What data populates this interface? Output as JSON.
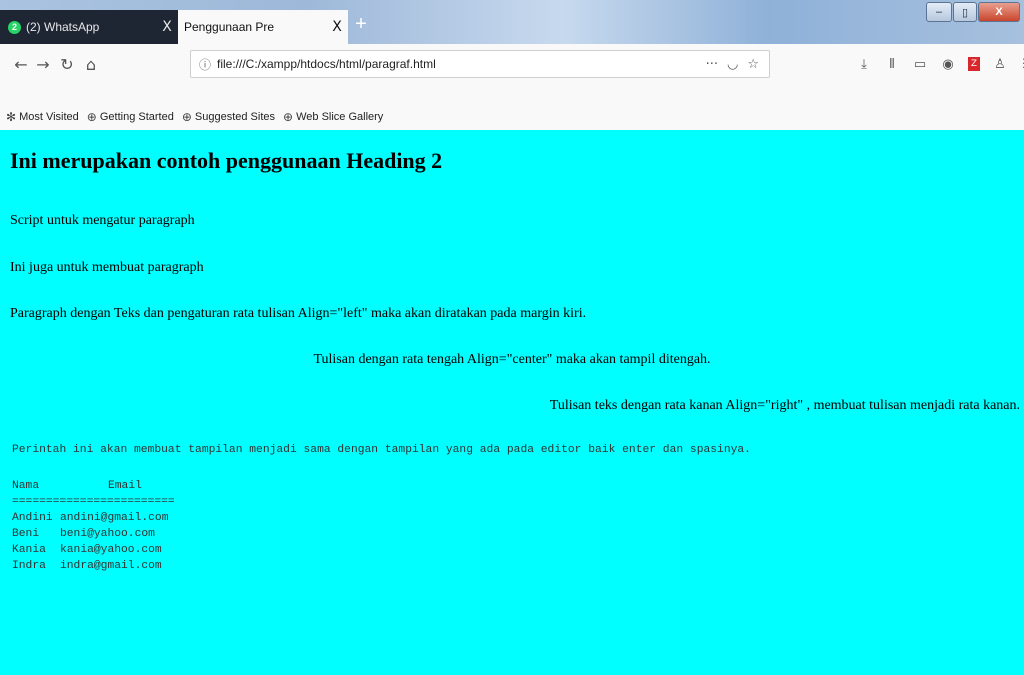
{
  "browser": {
    "tabs": [
      {
        "label": "(2) WhatsApp",
        "badge": "2",
        "close": "X"
      },
      {
        "label": "Penggunaan Pre",
        "close": "X"
      }
    ],
    "new_tab": "+",
    "window_controls": {
      "minimize": "–",
      "maximize": "▯",
      "close": "X"
    },
    "url": "file:///C:/xampp/htdocs/html/paragraf.html",
    "url_tools": {
      "more": "···",
      "pocket": "◡",
      "bookmark": "☆"
    },
    "toolbar_icons": [
      "download-icon",
      "library-icon",
      "reader-icon",
      "extension-icon",
      "red-extension-icon",
      "person-icon",
      "menu-icon"
    ],
    "bookmarks": [
      {
        "label": "Most Visited",
        "icon": "gear-icon"
      },
      {
        "label": "Getting Started",
        "icon": "globe-icon"
      },
      {
        "label": "Suggested Sites",
        "icon": "globe-icon"
      },
      {
        "label": "Web Slice Gallery",
        "icon": "globe-icon"
      }
    ]
  },
  "page": {
    "background": "#00ffff",
    "heading": "Ini merupakan contoh penggunaan Heading 2",
    "paragraphs": {
      "p1": "Script untuk mengatur paragraph",
      "p2": "Ini juga untuk membuat paragraph",
      "p3": "Paragraph dengan Teks dan pengaturan rata tulisan Align=\"left\" maka akan diratakan pada margin kiri.",
      "p4": "Tulisan dengan rata tengah Align=\"center\" maka akan tampil ditengah.",
      "p5": "Tulisan teks dengan rata kanan Align=\"right\" , membuat tulisan menjadi rata kanan."
    },
    "pre_text": "Perintah ini akan membuat tampilan menjadi sama dengan tampilan yang ada pada editor baik enter dan spasinya.",
    "table": {
      "header_name": "Nama",
      "header_email": "Email",
      "separator": "========================",
      "rows": [
        {
          "name": "Andini",
          "email": "andini@gmail.com"
        },
        {
          "name": "Beni",
          "email": "beni@yahoo.com"
        },
        {
          "name": "Kania",
          "email": "kania@yahoo.com"
        },
        {
          "name": "Indra",
          "email": "indra@gmail.com"
        }
      ]
    }
  }
}
